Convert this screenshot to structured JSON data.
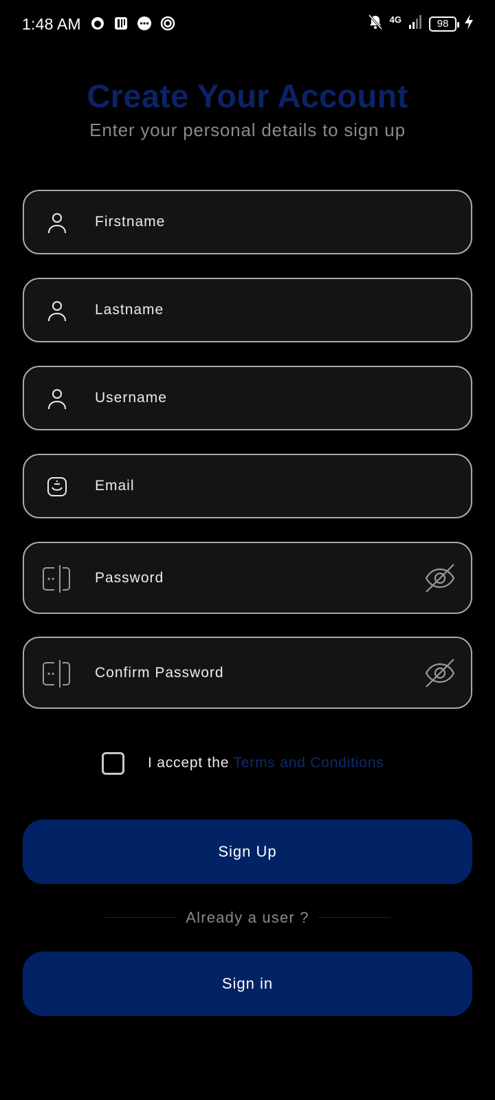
{
  "status_bar": {
    "time": "1:48 AM",
    "network": "4G",
    "battery": "98",
    "icons": [
      "app-icon",
      "parking-icon",
      "chat-icon",
      "sync-icon",
      "bell-off-icon",
      "signal-icon",
      "charging-icon"
    ]
  },
  "header": {
    "title": "Create Your Account",
    "subtitle": "Enter your personal details to sign up"
  },
  "form": {
    "firstname_placeholder": "Firstname",
    "lastname_placeholder": "Lastname",
    "username_placeholder": "Username",
    "email_placeholder": "Email",
    "password_placeholder": "Password",
    "confirm_password_placeholder": "Confirm Password"
  },
  "terms": {
    "prefix": "I accept the ",
    "link": "Terms and Conditions",
    "checked": false
  },
  "actions": {
    "signup_label": "Sign Up",
    "divider_text": "Already a user ?",
    "signin_label": "Sign in"
  },
  "colors": {
    "background": "#000000",
    "title": "#0b2366",
    "button": "#012365",
    "field_bg": "#141414",
    "field_border": "#a9a9a9",
    "link": "#0e2a70"
  }
}
